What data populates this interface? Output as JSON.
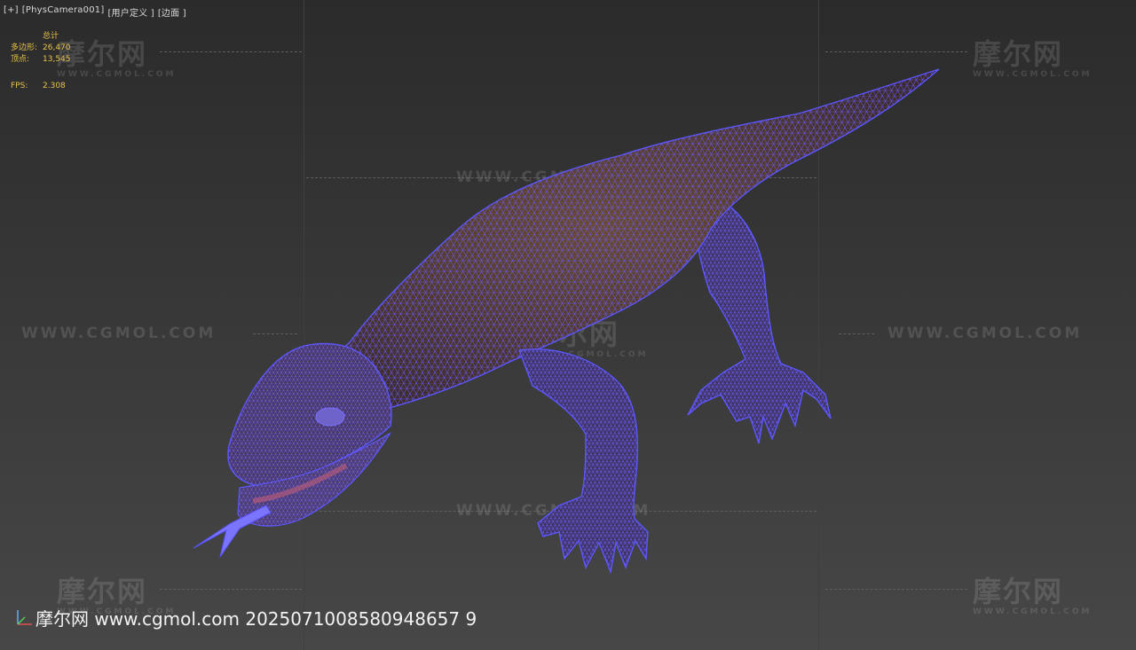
{
  "viewport": {
    "label_parts": [
      "[+]",
      "[PhysCamera001]",
      "[用户定义 ]",
      "[边面 ]"
    ]
  },
  "stats": {
    "header": "总计",
    "polygons_label": "多边形:",
    "polygons_value": "26,470",
    "vertices_label": "顶点:",
    "vertices_value": "13,545",
    "fps_label": "FPS:",
    "fps_value": "2.308"
  },
  "watermarks": {
    "logo_text": "摩尔网",
    "logo_sub": "WWW.CGMOL.COM",
    "url_text": "WWW.CGMOL.COM"
  },
  "credit": {
    "text": "摩尔网 www.cgmol.com 2025071008580948657 9"
  },
  "colors": {
    "wire": "#5a55ff",
    "body": "#5a4029",
    "stats": "#e8c24a"
  }
}
